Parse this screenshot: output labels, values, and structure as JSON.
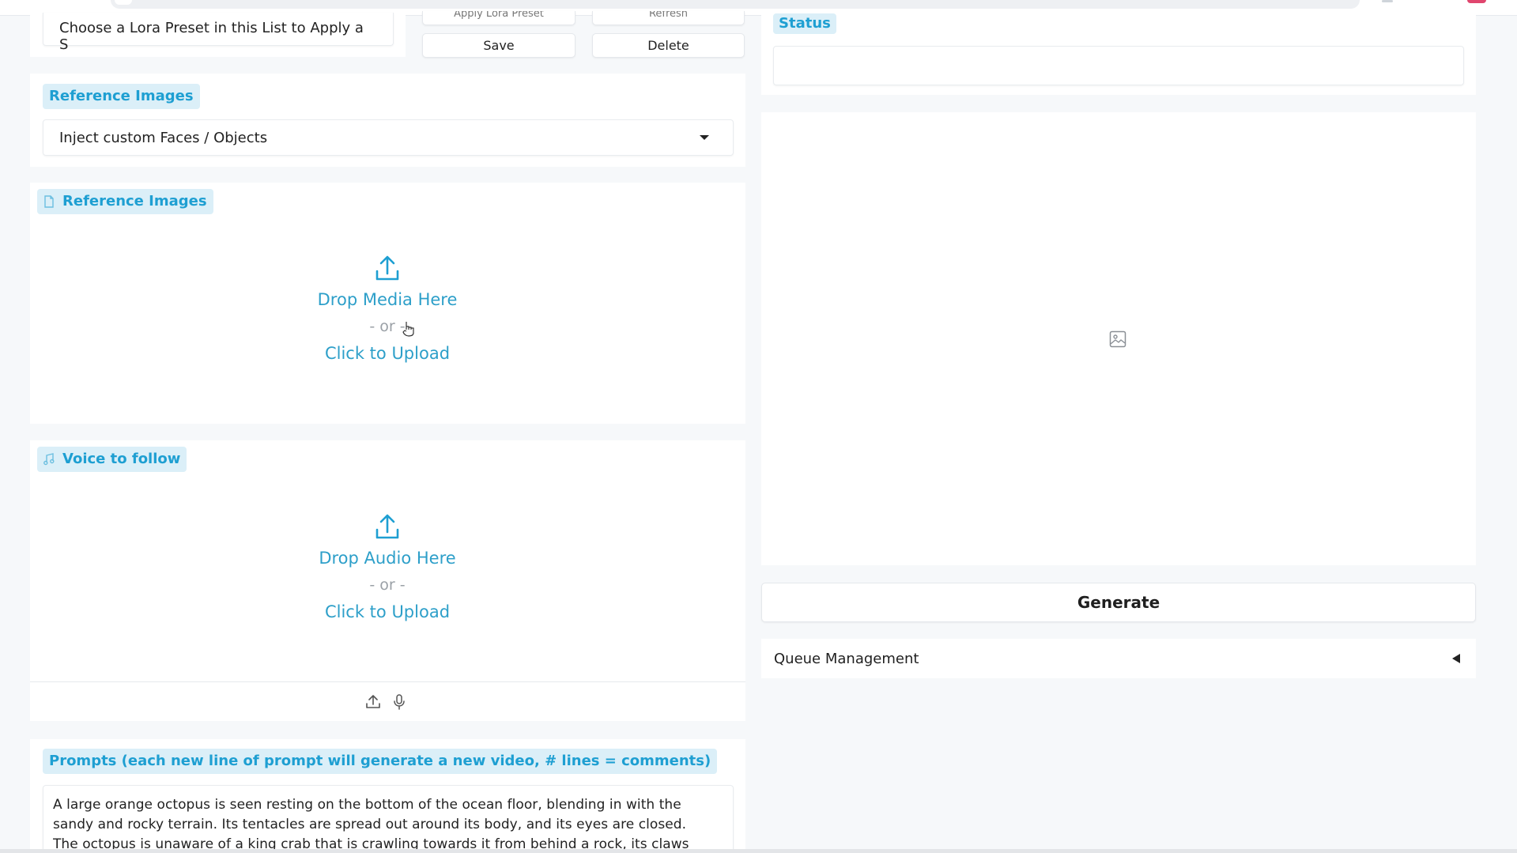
{
  "lora": {
    "preset_placeholder": "Choose a Lora Preset in this List to Apply a S",
    "apply_label_cut": "Apply Lora Preset",
    "refresh_label_cut": "Refresh",
    "save_label": "Save",
    "delete_label": "Delete"
  },
  "reference_images_section": {
    "label": "Reference Images",
    "dropdown_value": "Inject custom Faces / Objects"
  },
  "reference_images_upload": {
    "label": "Reference Images",
    "drop_text": "Drop Media Here",
    "or_text": "- or -",
    "click_text": "Click to Upload"
  },
  "voice_upload": {
    "label": "Voice to follow",
    "drop_text": "Drop Audio Here",
    "or_text": "- or -",
    "click_text": "Click to Upload"
  },
  "prompts": {
    "label": "Prompts (each new line of prompt will generate a new video, # lines = comments)",
    "lines": [
      "A large orange octopus is seen resting on the bottom of the ocean floor, blending in with the",
      "sandy and rocky terrain. Its tentacles are spread out around its body, and its eyes are closed.",
      "The octopus is unaware of a king crab that is crawling towards it from behind a rock, its claws"
    ]
  },
  "status": {
    "label": "Status",
    "value": ""
  },
  "output": {
    "placeholder_icon": "image-icon"
  },
  "generate": {
    "label": "Generate"
  },
  "queue": {
    "label": "Queue Management",
    "toggle_icon": "triangle-left-icon"
  },
  "colors": {
    "accent": "#1e9fd2",
    "chip_bg": "#dbeff8",
    "page_bg": "#f6f8fa"
  }
}
